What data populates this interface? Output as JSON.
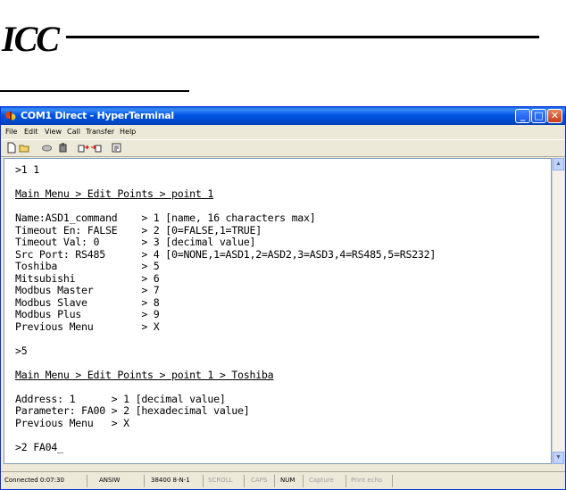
{
  "logo": {
    "text": "ICC"
  },
  "window": {
    "title": "COM1 Direct - HyperTerminal",
    "minimize_label": "_",
    "maximize_label": "□",
    "close_label": "✕"
  },
  "menubar": {
    "items": [
      {
        "label": "File"
      },
      {
        "label": "Edit"
      },
      {
        "label": "View"
      },
      {
        "label": "Call"
      },
      {
        "label": "Transfer"
      },
      {
        "label": "Help"
      }
    ]
  },
  "toolbar": {
    "icons": [
      "new-icon",
      "open-icon",
      "disconnect-icon",
      "properties-phone-icon",
      "send-icon",
      "receive-icon",
      "properties-icon"
    ]
  },
  "terminal": {
    "lines": [
      {
        "text": ">1 1",
        "header": false
      },
      {
        "text": "",
        "header": false
      },
      {
        "text": "Main Menu > Edit Points > point 1",
        "header": true
      },
      {
        "text": "",
        "header": false
      },
      {
        "text": "Name:ASD1_command    > 1 [name, 16 characters max]",
        "header": false
      },
      {
        "text": "Timeout En: FALSE    > 2 [0=FALSE,1=TRUE]",
        "header": false
      },
      {
        "text": "Timeout Val: 0       > 3 [decimal value]",
        "header": false
      },
      {
        "text": "Src Port: RS485      > 4 [0=NONE,1=ASD1,2=ASD2,3=ASD3,4=RS485,5=RS232]",
        "header": false
      },
      {
        "text": "Toshiba              > 5",
        "header": false
      },
      {
        "text": "Mitsubishi           > 6",
        "header": false
      },
      {
        "text": "Modbus Master        > 7",
        "header": false
      },
      {
        "text": "Modbus Slave         > 8",
        "header": false
      },
      {
        "text": "Modbus Plus          > 9",
        "header": false
      },
      {
        "text": "Previous Menu        > X",
        "header": false
      },
      {
        "text": "",
        "header": false
      },
      {
        "text": ">5",
        "header": false
      },
      {
        "text": "",
        "header": false
      },
      {
        "text": "Main Menu > Edit Points > point 1 > Toshiba",
        "header": true
      },
      {
        "text": "",
        "header": false
      },
      {
        "text": "Address: 1      > 1 [decimal value]",
        "header": false
      },
      {
        "text": "Parameter: FA00 > 2 [hexadecimal value]",
        "header": false
      },
      {
        "text": "Previous Menu   > X",
        "header": false
      },
      {
        "text": "",
        "header": false
      },
      {
        "text": ">2 FA04_",
        "header": false
      }
    ]
  },
  "statusbar": {
    "connected": "Connected 0:07:30",
    "emulation": "ANSIW",
    "settings": "38400 8-N-1",
    "scroll": "SCROLL",
    "caps": "CAPS",
    "num": "NUM",
    "capture": "Capture",
    "print_echo": "Print echo"
  },
  "colors": {
    "titlebar": "#0054e3",
    "window_frame": "#ece9d8",
    "terminal_bg": "#ffffff"
  }
}
